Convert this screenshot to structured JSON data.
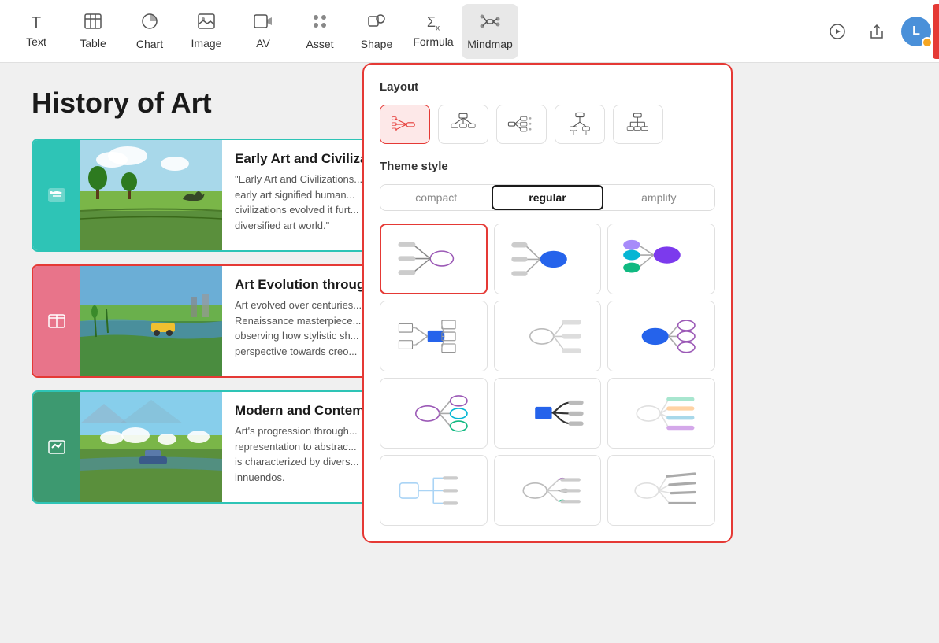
{
  "toolbar": {
    "items": [
      {
        "id": "text",
        "label": "Text",
        "icon": "T"
      },
      {
        "id": "table",
        "label": "Table",
        "icon": "⊞"
      },
      {
        "id": "chart",
        "label": "Chart",
        "icon": "◑"
      },
      {
        "id": "image",
        "label": "Image",
        "icon": "⬚"
      },
      {
        "id": "av",
        "label": "AV",
        "icon": "▶⬚"
      },
      {
        "id": "asset",
        "label": "Asset",
        "icon": "⁂"
      },
      {
        "id": "shape",
        "label": "Shape",
        "icon": "⬡"
      },
      {
        "id": "formula",
        "label": "Formula",
        "icon": "Σ"
      },
      {
        "id": "mindmap",
        "label": "Mindmap",
        "icon": "⋈",
        "active": true
      }
    ],
    "play_btn": "▶",
    "share_btn": "↑",
    "avatar_letter": "L"
  },
  "document": {
    "title": "History of Art",
    "cards": [
      {
        "id": "card1",
        "title": "Early Art and Civiliza...",
        "text": "\"Early Art and Civilizations... early art signified human... civilizations evolved it furt... diversified art world.\"",
        "border": "teal",
        "icon": "💬",
        "icon_bg": "teal"
      },
      {
        "id": "card2",
        "title": "Art Evolution throug...",
        "text": "Art evolved over centuries... Renaissance masterpiece... observing how stylistic sh... perspective towards creo...",
        "border": "red",
        "icon": "✉",
        "icon_bg": "pink"
      },
      {
        "id": "card3",
        "title": "Modern and Contemp...",
        "text": "Art's progression through... representation to abstrac... is characterized by divers... innuendos.",
        "border": "green",
        "icon": "✓",
        "icon_bg": "green"
      }
    ]
  },
  "mindmap_panel": {
    "layout_label": "Layout",
    "theme_label": "Theme style",
    "theme_tabs": [
      "compact",
      "regular",
      "amplify"
    ],
    "active_theme_tab": "regular",
    "layout_options": [
      {
        "id": "fishbone-left",
        "selected": true
      },
      {
        "id": "tree-down"
      },
      {
        "id": "tree-right"
      },
      {
        "id": "tree-top"
      },
      {
        "id": "tree-top-right"
      }
    ],
    "style_cells": [
      {
        "id": "s1",
        "selected": true
      },
      {
        "id": "s2"
      },
      {
        "id": "s3"
      },
      {
        "id": "s4"
      },
      {
        "id": "s5"
      },
      {
        "id": "s6"
      },
      {
        "id": "s7"
      },
      {
        "id": "s8"
      },
      {
        "id": "s9"
      },
      {
        "id": "s10"
      },
      {
        "id": "s11"
      },
      {
        "id": "s12"
      }
    ]
  }
}
